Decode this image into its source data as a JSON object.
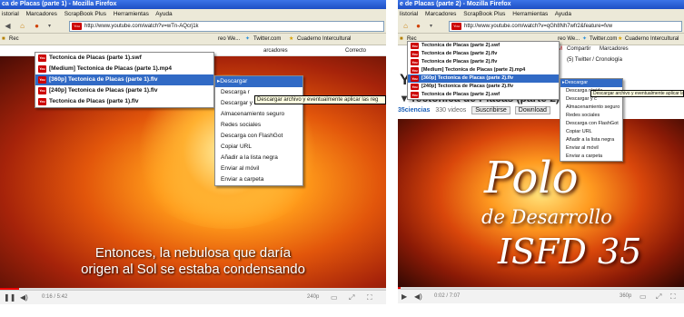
{
  "shot1": {
    "title": "ca de Placas (parte 1) - Mozilla Firefox",
    "menu": [
      "istorial",
      "Marcadores",
      "ScrapBook Plus",
      "Herramientas",
      "Ayuda"
    ],
    "url": "http://www.youtube.com/watch?v=wTn-AQcrj1k",
    "bookmarks": {
      "rec": "Rec",
      "more": "reo We...",
      "twitter": "Twitter.com",
      "cuaderno": "Cuaderno Intercultural",
      "marcadores": "arcadores",
      "correct": "Correcto"
    },
    "downloads": [
      "Tectonica de Placas (parte 1).swf",
      "[Medium] Tectonica de Placas (parte 1).mp4",
      "[360p] Tectonica de Placas (parte 1).flv",
      "[240p] Tectonica de Placas (parte 1).flv",
      "Tectonica de Placas (parte 1).flv"
    ],
    "selected_index": 2,
    "context_menu": [
      "Descargar",
      "Descarga r",
      "Descargar y convertir",
      "Almacenamiento seguro",
      "Redes sociales",
      "Descarga con FlashGot",
      "Copiar URL",
      "Añadir a la lista negra",
      "Enviar al móvil",
      "Enviar a carpeta"
    ],
    "tooltip": "Descargar archivo y eventualmente aplicar las reg",
    "subtitle_line1": "Entonces, la nebulosa que daría",
    "subtitle_line2": "origen al Sol se estaba condensando",
    "time": "0:16 / 5:42",
    "quality": "240p"
  },
  "shot2": {
    "title": "e de Placas (parte 2) - Mozilla Firefox",
    "menu": [
      "listorial",
      "Marcadores",
      "ScrapBook Plus",
      "Herramientas",
      "Ayuda"
    ],
    "url": "http://www.youtube.com/watch?v=qGh8Nh7wfr2&feature=fvw",
    "bookmarks": {
      "rec": "Rec",
      "more": "reo We...",
      "twitter": "Twitter.com",
      "cuaderno": "Cuaderno Intercultural",
      "compartir": "Compartir",
      "marcadores": "Marcadores",
      "twitter2": "(5) Twitter / Cronología"
    },
    "downloads": [
      "Tectonica de Placas (parte 2).swf",
      "Tectonica de Placas (parte 2).flv",
      "Tectonica de Placas (parte 2).flv",
      "[Medium] Tectonica de Placas (parte 2).mp4",
      "[360p] Tectonica de Placas (parte 2).flv",
      "[240p] Tectonica de Placas (parte 2).flv",
      "Tectonica de Placas (parte 2).swf"
    ],
    "selected_index": 4,
    "context_menu": [
      "Descargar",
      "Descarga rápida",
      "Descargar y c",
      "Almacenamiento seguro",
      "Redes sociales",
      "Descarga con FlashGot",
      "Copiar URL",
      "Añadir a la lista negra",
      "Enviar al móvil",
      "Enviar a carpeta"
    ],
    "tooltip": "Descargar archivo y eventualmente aplicar las reg",
    "page_logo": "You",
    "video_title": "Tectonica de Placas (parte 2)",
    "channel": "35ciencias",
    "views": "330 videos",
    "subscribe": "Suscribirse",
    "download_btn": "Download",
    "polo": "Polo",
    "desarrollo": "de Desarrollo",
    "isfd": "ISFD 35",
    "time": "0:02 / 7:07",
    "quality": "360p"
  },
  "colors": {
    "selection": "#316ac5",
    "tooltip_bg": "#ffffe1",
    "titlebar": "#1d4fc4"
  }
}
